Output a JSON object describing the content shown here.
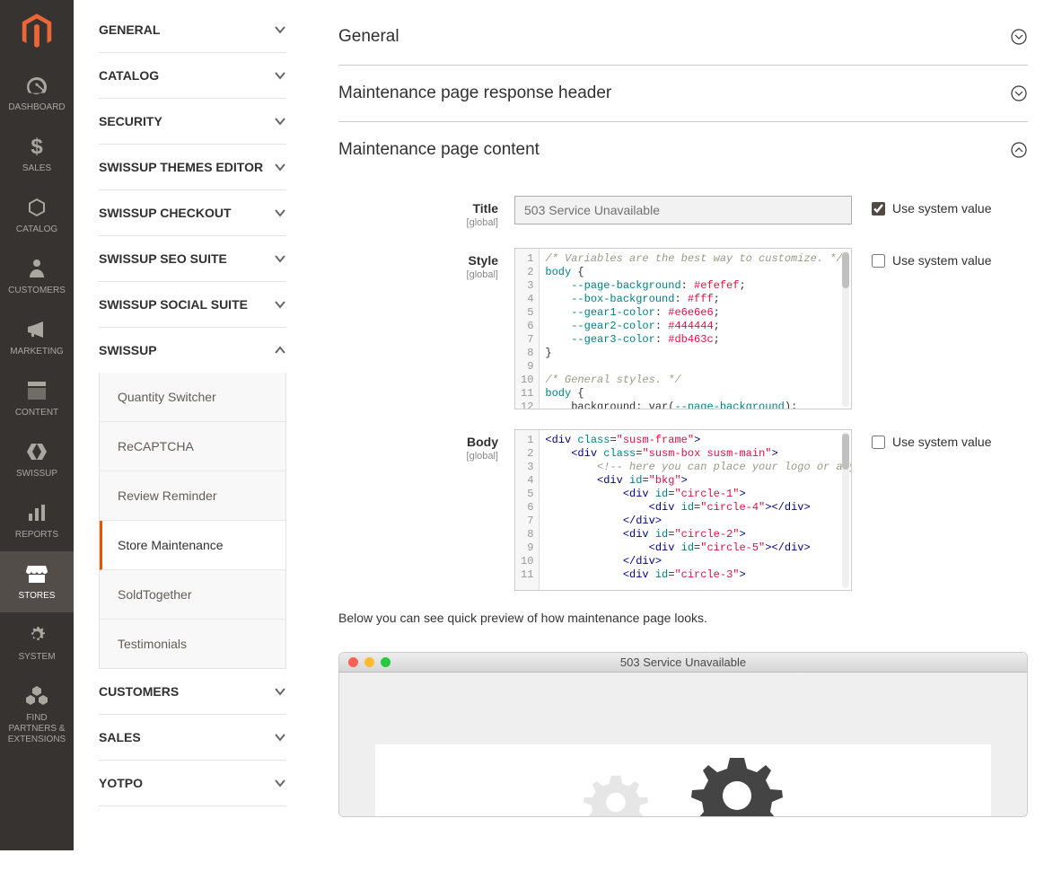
{
  "admin_nav": [
    {
      "id": "dashboard",
      "label": "DASHBOARD",
      "icon": "gauge"
    },
    {
      "id": "sales",
      "label": "SALES",
      "icon": "dollar"
    },
    {
      "id": "catalog",
      "label": "CATALOG",
      "icon": "cube"
    },
    {
      "id": "customers",
      "label": "CUSTOMERS",
      "icon": "person"
    },
    {
      "id": "marketing",
      "label": "MARKETING",
      "icon": "megaphone"
    },
    {
      "id": "content",
      "label": "CONTENT",
      "icon": "layout"
    },
    {
      "id": "swissup",
      "label": "SWISSUP",
      "icon": "hex"
    },
    {
      "id": "reports",
      "label": "REPORTS",
      "icon": "bars"
    },
    {
      "id": "stores",
      "label": "STORES",
      "icon": "store",
      "active": true
    },
    {
      "id": "system",
      "label": "SYSTEM",
      "icon": "gear"
    },
    {
      "id": "partners",
      "label": "FIND PARTNERS & EXTENSIONS",
      "icon": "cubes"
    }
  ],
  "config_tabs": [
    {
      "id": "general",
      "label": "GENERAL",
      "expanded": false
    },
    {
      "id": "catalog",
      "label": "CATALOG",
      "expanded": false
    },
    {
      "id": "security",
      "label": "SECURITY",
      "expanded": false
    },
    {
      "id": "swissup_themes",
      "label": "SWISSUP THEMES EDITOR",
      "expanded": false
    },
    {
      "id": "swissup_checkout",
      "label": "SWISSUP CHECKOUT",
      "expanded": false
    },
    {
      "id": "swissup_seo",
      "label": "SWISSUP SEO SUITE",
      "expanded": false
    },
    {
      "id": "swissup_social",
      "label": "SWISSUP SOCIAL SUITE",
      "expanded": false
    },
    {
      "id": "swissup",
      "label": "SWISSUP",
      "expanded": true,
      "items": [
        {
          "id": "qty",
          "label": "Quantity Switcher"
        },
        {
          "id": "recaptcha",
          "label": "ReCAPTCHA"
        },
        {
          "id": "review",
          "label": "Review Reminder"
        },
        {
          "id": "maintenance",
          "label": "Store Maintenance",
          "active": true
        },
        {
          "id": "soldtogether",
          "label": "SoldTogether"
        },
        {
          "id": "testimonials",
          "label": "Testimonials"
        }
      ]
    },
    {
      "id": "customers",
      "label": "CUSTOMERS",
      "expanded": false
    },
    {
      "id": "sales_tab",
      "label": "SALES",
      "expanded": false
    },
    {
      "id": "yotpo",
      "label": "YOTPO",
      "expanded": false
    }
  ],
  "sections": {
    "general": {
      "title": "General",
      "expanded": false
    },
    "response_header": {
      "title": "Maintenance page response header",
      "expanded": false
    },
    "content": {
      "title": "Maintenance page content",
      "expanded": true
    }
  },
  "fields": {
    "title": {
      "label": "Title",
      "scope": "[global]",
      "value": "503 Service Unavailable",
      "use_system": true,
      "use_system_label": "Use system value"
    },
    "style": {
      "label": "Style",
      "scope": "[global]",
      "use_system": false,
      "use_system_label": "Use system value",
      "lines": [
        {
          "type": "comment",
          "text": "/* Variables are the best way to customize. */"
        },
        {
          "type": "css",
          "sel": "body",
          "text": " {"
        },
        {
          "type": "decl",
          "prop": "--page-background",
          "val": "#efefef"
        },
        {
          "type": "decl",
          "prop": "--box-background",
          "val": "#fff"
        },
        {
          "type": "decl",
          "prop": "--gear1-color",
          "val": "#e6e6e6"
        },
        {
          "type": "decl",
          "prop": "--gear2-color",
          "val": "#444444"
        },
        {
          "type": "decl",
          "prop": "--gear3-color",
          "val": "#db463c"
        },
        {
          "type": "plain",
          "text": "}"
        },
        {
          "type": "blank",
          "text": ""
        },
        {
          "type": "comment",
          "text": "/* General styles. */"
        },
        {
          "type": "css",
          "sel": "body",
          "text": " {"
        },
        {
          "type": "decl2",
          "prop": "background",
          "func": "var",
          "arg": "--page-background"
        }
      ]
    },
    "body": {
      "label": "Body",
      "scope": "[global]",
      "use_system": false,
      "use_system_label": "Use system value"
    }
  },
  "preview": {
    "intro": "Below you can see quick preview of how maintenance page looks.",
    "title": "503 Service Unavailable",
    "gear1_color": "#e6e6e6",
    "gear2_color": "#444444"
  }
}
